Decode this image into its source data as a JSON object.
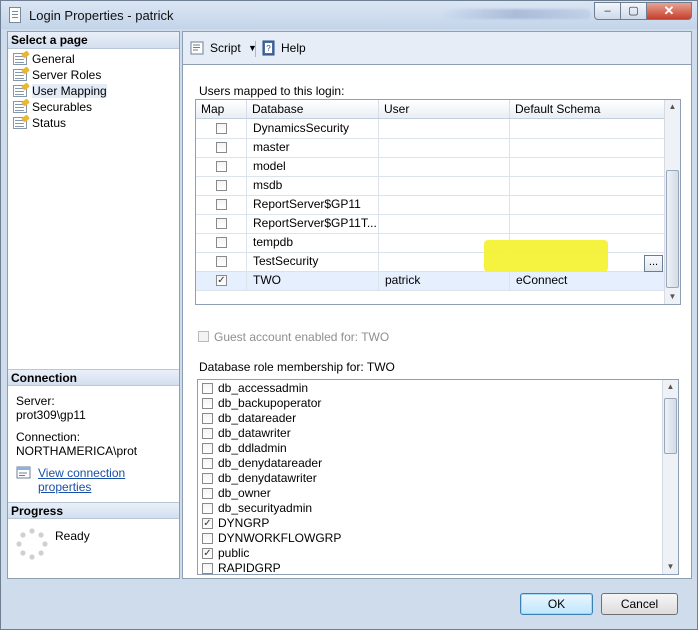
{
  "window": {
    "title": "Login Properties - patrick",
    "controls": {
      "minimize": "–",
      "maximize": "▢",
      "close": "✕"
    }
  },
  "sidebar": {
    "header": "Select a page",
    "pages": [
      {
        "label": "General",
        "icon": "page-icon"
      },
      {
        "label": "Server Roles",
        "icon": "page-icon"
      },
      {
        "label": "User Mapping",
        "icon": "page-icon",
        "selected": true
      },
      {
        "label": "Securables",
        "icon": "page-icon"
      },
      {
        "label": "Status",
        "icon": "page-icon"
      }
    ],
    "connection": {
      "header": "Connection",
      "server_label": "Server:",
      "server_value": "prot309\\gp11",
      "connection_label": "Connection:",
      "connection_value": "NORTHAMERICA\\prot",
      "link": "View connection properties"
    },
    "progress": {
      "header": "Progress",
      "status": "Ready"
    }
  },
  "toolbar": {
    "script_label": "Script",
    "help_label": "Help"
  },
  "users_mapped": {
    "label": "Users mapped to this login:",
    "columns": [
      "Map",
      "Database",
      "User",
      "Default Schema"
    ],
    "rows": [
      {
        "map": false,
        "database": "DynamicsSecurity",
        "user": "",
        "schema": ""
      },
      {
        "map": false,
        "database": "master",
        "user": "",
        "schema": ""
      },
      {
        "map": false,
        "database": "model",
        "user": "",
        "schema": ""
      },
      {
        "map": false,
        "database": "msdb",
        "user": "",
        "schema": ""
      },
      {
        "map": false,
        "database": "ReportServer$GP11",
        "user": "",
        "schema": ""
      },
      {
        "map": false,
        "database": "ReportServer$GP11T...",
        "user": "",
        "schema": ""
      },
      {
        "map": false,
        "database": "tempdb",
        "user": "",
        "schema": ""
      },
      {
        "map": false,
        "database": "TestSecurity",
        "user": "",
        "schema": ""
      },
      {
        "map": true,
        "database": "TWO",
        "user": "patrick",
        "schema": "eConnect",
        "selected": true
      }
    ],
    "ellipsis": "..."
  },
  "guest_account": {
    "label": "Guest account enabled for: TWO",
    "checked": false
  },
  "role_membership": {
    "label": "Database role membership for: TWO",
    "roles": [
      {
        "name": "db_accessadmin",
        "checked": false
      },
      {
        "name": "db_backupoperator",
        "checked": false
      },
      {
        "name": "db_datareader",
        "checked": false
      },
      {
        "name": "db_datawriter",
        "checked": false
      },
      {
        "name": "db_ddladmin",
        "checked": false
      },
      {
        "name": "db_denydatareader",
        "checked": false
      },
      {
        "name": "db_denydatawriter",
        "checked": false
      },
      {
        "name": "db_owner",
        "checked": false
      },
      {
        "name": "db_securityadmin",
        "checked": false
      },
      {
        "name": "DYNGRP",
        "checked": true
      },
      {
        "name": "DYNWORKFLOWGRP",
        "checked": false
      },
      {
        "name": "public",
        "checked": true
      },
      {
        "name": "RAPIDGRP",
        "checked": false
      }
    ]
  },
  "footer": {
    "ok_label": "OK",
    "cancel_label": "Cancel"
  },
  "colors": {
    "highlight": "#f4f22b",
    "selected_row": "#cfe1fb",
    "link": "#1a4fa8"
  }
}
